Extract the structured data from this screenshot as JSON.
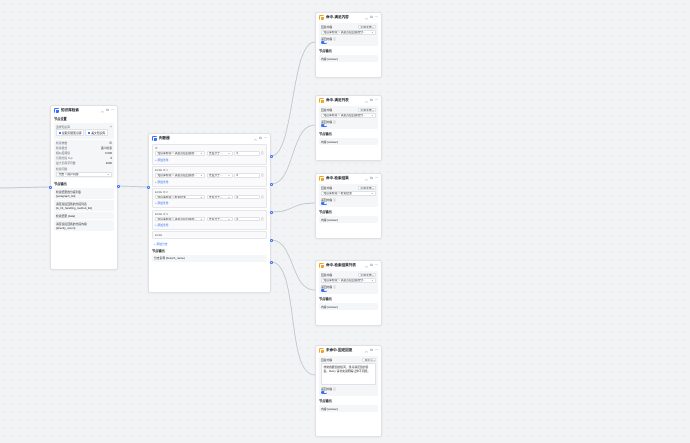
{
  "kb_node": {
    "title": "知识库检索",
    "input_label": "节点设置",
    "select_kb_label": "选择知识库",
    "kbs": [
      "提取问答知识库",
      "美文知识库"
    ],
    "search_params_label": "检索参数",
    "params": [
      {
        "k": "检索模式",
        "v": "语义检索"
      },
      {
        "k": "相似度阈值",
        "v": "0.600"
      },
      {
        "k": "引用分段 Top",
        "v": "6"
      },
      {
        "k": "最大引用字符数",
        "v": "2000"
      }
    ],
    "rerank_label": "检索问题",
    "rerank_value": "开始 > 用户问题",
    "output_label": "节点输出",
    "outputs": [
      {
        "name": "检索结果的分段列表",
        "key": "[paragraph_list]"
      },
      {
        "name": "满足直接回答的分段列表",
        "key": "[is_hit_handling_method_list]"
      },
      {
        "name": "检索结果",
        "key": "[data]"
      },
      {
        "name": "满足直接回答的分段内容",
        "key": "[directly_return]"
      }
    ]
  },
  "cond_node": {
    "title": "判断器",
    "branches": [
      {
        "label": "IF",
        "field": "知识库检索 > 满足直接回答的...",
        "op": "长度大于...",
        "value": "0",
        "add": "+ 添加条件"
      },
      {
        "label": "ELSE IF 1",
        "field": "知识库检索 > 满足直接回答的...",
        "op": "长度大于...",
        "value": "0",
        "add": "+ 添加条件"
      },
      {
        "label": "ELSE IF 2",
        "field": "知识库检索 > 检索结果",
        "op": "长度大于...",
        "value": "0",
        "add": "+ 添加条件"
      },
      {
        "label": "ELSE IF 3",
        "field": "知识库检索 > 满足直接回答的...",
        "op": "长度大于...",
        "value": "0",
        "add": "+ 添加条件"
      }
    ],
    "else_label": "ELSE",
    "add_branch": "+ 添加分支",
    "output_label": "节点输出",
    "output_value": "分支名称 [branch_name]"
  },
  "right_nodes": [
    {
      "title": "命中-满足内容",
      "content_label": "回复内容",
      "content_mode": "引用变量",
      "content_value": "知识库检索 > 满足直接回答的分...",
      "return_label": "返回内容",
      "output_label": "节点输出",
      "output_value": "内容 [answer]"
    },
    {
      "title": "命中-满足列表",
      "content_label": "回复内容",
      "content_mode": "引用变量",
      "content_value": "知识库检索 > 满足直接回答的分...",
      "return_label": "返回内容",
      "output_label": "节点输出",
      "output_value": "内容 [answer]"
    },
    {
      "title": "命中-检索结果",
      "content_label": "回复内容",
      "content_mode": "引用变量",
      "content_value": "知识库检索 > 检索结果",
      "return_label": "返回内容",
      "output_label": "节点输出",
      "output_value": "内容 [answer]"
    },
    {
      "title": "命中-检索结果列表",
      "content_label": "回复内容",
      "content_mode": "引用变量",
      "content_value": "知识库检索 > 满足直接回答的分...",
      "return_label": "返回内容",
      "output_label": "节点输出",
      "output_value": "内容 [answer]"
    }
  ],
  "fixed_node": {
    "title": "未命中-固定回复",
    "content_label": "回复内容",
    "content_mode": "自定义",
    "content_text": "非常抱歉您的提问，找寻满足您的答案，Retry 请补充说明等让你不问能。",
    "return_label": "返回内容",
    "output_label": "节点输出",
    "output_value": "内容 [answer]"
  },
  "icons": {
    "expand": "chevron-up-icon",
    "copy": "copy-icon",
    "more": "more-icon"
  }
}
